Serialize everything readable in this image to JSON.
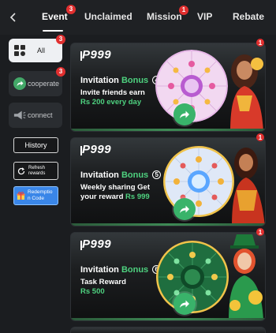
{
  "tabs": [
    {
      "label": "Event",
      "badge": "3",
      "active": true
    },
    {
      "label": "Unclaimed",
      "badge": "",
      "active": false
    },
    {
      "label": "Mission",
      "badge": "1",
      "active": false
    },
    {
      "label": "VIP",
      "badge": "",
      "active": false
    },
    {
      "label": "Rebate",
      "badge": "",
      "active": false
    }
  ],
  "sidebar": {
    "categories": [
      {
        "label": "All",
        "badge": "3",
        "icon": "grid-icon"
      },
      {
        "label": "cooperate",
        "badge": "3",
        "icon": "share-arrow-icon"
      },
      {
        "label": "connect",
        "badge": "",
        "icon": "megaphone-icon"
      }
    ],
    "history_label": "History",
    "refresh_label": "Refresh rewards",
    "redeem_label": "Redemption Code"
  },
  "cards": [
    {
      "logo": "P999",
      "title_prefix": "Invitation",
      "title_bonus": "Bonus",
      "number": "4",
      "line1": "Invite friends earn",
      "line2_prefix": "",
      "line2_highlight": "Rs 200 every day",
      "badge": "1",
      "wheel": "pink-prize-wheel"
    },
    {
      "logo": "P999",
      "title_prefix": "Invitation",
      "title_bonus": "Bonus",
      "number": "5",
      "line1": "Weekly sharing Get",
      "line2_prefix": "your reward",
      "line2_highlight": "Rs 999",
      "badge": "1",
      "wheel": "blue-prize-wheel"
    },
    {
      "logo": "P999",
      "title_prefix": "Invitation",
      "title_bonus": "Bonus",
      "number": "6",
      "line1": "Task Reward",
      "line2_prefix": "",
      "line2_highlight": "Rs 500",
      "badge": "1",
      "wheel": "green-prize-wheel"
    }
  ],
  "colors": {
    "background": "#1b1d20",
    "accent_green": "#4ed17f",
    "badge_red": "#e12f2f",
    "redeem_blue": "#3a86e8"
  }
}
